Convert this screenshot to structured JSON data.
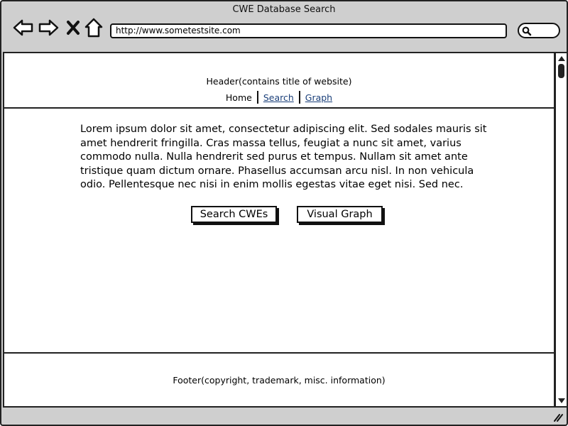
{
  "window": {
    "title": "CWE Database Search"
  },
  "browser": {
    "url": "http://www.sometestsite.com",
    "icons": [
      "back-arrow-icon",
      "forward-arrow-icon",
      "close-icon",
      "home-icon",
      "search-icon"
    ]
  },
  "header": {
    "title": "Header(contains title of website)",
    "nav": {
      "home": "Home",
      "search": "Search",
      "graph": "Graph"
    }
  },
  "main": {
    "paragraph": "Lorem ipsum dolor sit amet, consectetur adipiscing elit. Sed sodales mauris sit amet hendrerit fringilla. Cras massa tellus, feugiat a nunc sit amet, varius commodo nulla. Nulla hendrerit sed purus et tempus. Nullam sit amet ante tristique quam dictum ornare. Phasellus accumsan arcu nisl. In non vehicula odio. Pellentesque nec nisi in enim mollis egestas vitae eget nisi. Sed nec.",
    "buttons": {
      "search": "Search CWEs",
      "graph": "Visual Graph"
    }
  },
  "footer": {
    "text": "Footer(copyright, trademark, misc. information)"
  },
  "colors": {
    "chrome": "#cfcfcf",
    "link": "#1a3f7a"
  }
}
